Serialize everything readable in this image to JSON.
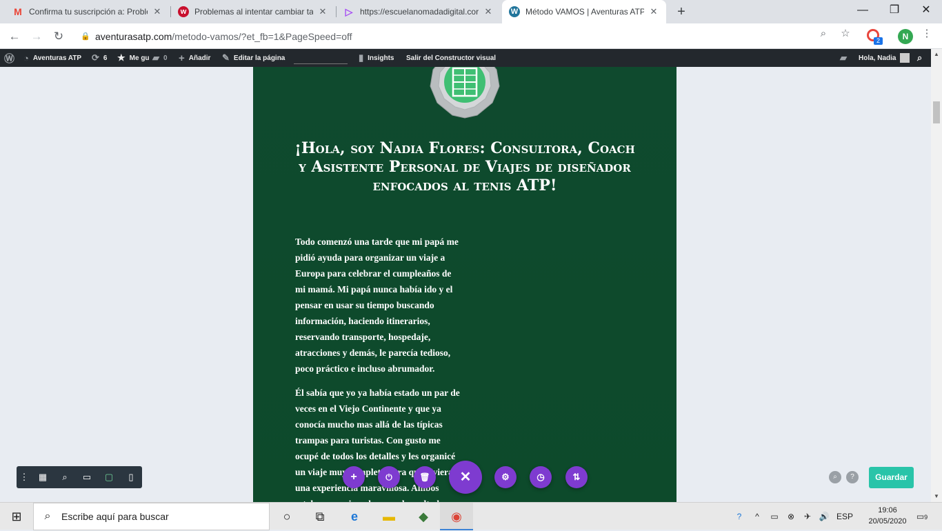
{
  "browser": {
    "tabs": [
      {
        "title": "Confirma tu suscripción a: Proble",
        "icon": "gmail-icon",
        "active": false
      },
      {
        "title": "Problemas al intentar cambiar ta",
        "icon": "site-icon",
        "active": false
      },
      {
        "title": "https://escuelanomadadigital.cor",
        "icon": "play-icon",
        "active": false
      },
      {
        "title": "Método VAMOS | Aventuras ATP",
        "icon": "wordpress-icon",
        "active": true
      }
    ],
    "url_domain": "aventurasatp.com",
    "url_path": "/metodo-vamos/?et_fb=1&PageSpeed=off",
    "profile_initial": "N",
    "extension_badge": "2"
  },
  "adminbar": {
    "site_name": "Aventuras ATP",
    "updates_count": "6",
    "me_gu": "Me gu",
    "comments_count": "0",
    "add_new": "Añadir",
    "edit_page": "Editar la página",
    "insights": "Insights",
    "exit_builder": "Salir del Constructor visual",
    "greeting": "Hola, Nadia"
  },
  "page": {
    "headline": "¡Hola, soy Nadia Flores: Consultora, Coach y Asistente Personal de Viajes de diseñador enfocados al tenis ATP!",
    "paragraph1": "Todo comenzó una tarde que mi papá me pidió ayuda para organizar un viaje a Europa para celebrar el cumpleaños de mi mamá. Mi papá nunca había ido y el pensar en usar su tiempo buscando información, haciendo itinerarios, reservando transporte, hospedaje, atracciones y demás, le parecía tedioso, poco práctico e incluso abrumador.",
    "paragraph2": "Él sabía que yo ya había estado un par de veces en el Viejo Continente y que ya conocía mucho mas allá de las típicas trampas para turistas. Con gusto me ocupé de todos los detalles y les organicé un viaje muy completo para que vivieran una experiencia maravillosa. Ambos estaban emocionados con el resultado"
  },
  "builder": {
    "save_label": "Guardar"
  },
  "taskbar": {
    "search_placeholder": "Escribe aquí para buscar",
    "language": "ESP",
    "time": "19:06",
    "date": "20/05/2020",
    "notifications": "9"
  }
}
